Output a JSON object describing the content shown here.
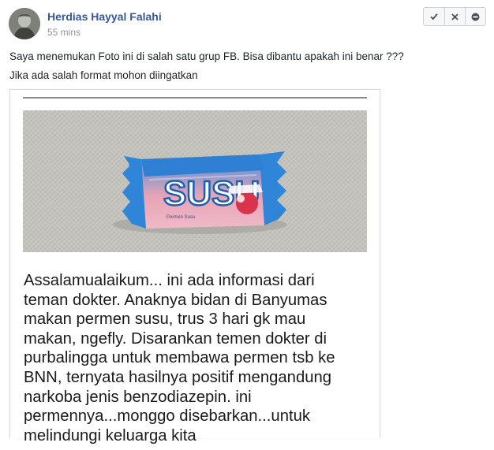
{
  "post": {
    "author": "Herdias Hayyal Falahi",
    "timestamp": "55 mins",
    "text_lines": [
      "Saya menemukan Foto ini di salah satu grup FB. Bisa dibantu apakah ini benar ???",
      "Jika ada salah format mohon diingatkan"
    ]
  },
  "moderation_actions": [
    {
      "name": "approve-button",
      "icon": "check-icon",
      "glyph": "✔"
    },
    {
      "name": "decline-button",
      "icon": "close-icon",
      "glyph": "✖"
    },
    {
      "name": "block-button",
      "icon": "minus-circle-icon",
      "glyph": "⊖"
    }
  ],
  "attachment": {
    "product": {
      "brand": "SUSU",
      "small_label": "Permen Susu",
      "colors": {
        "wrapper": "#2f86d8",
        "pink": "#e9a6b9",
        "red": "#d9344b",
        "white": "#ffffff"
      }
    },
    "caption_lines": [
      "Assalamualaikum... ini ada informasi dari",
      "teman dokter. Anaknya bidan di Banyumas",
      "makan permen susu, trus 3 hari gk mau",
      "makan, ngefly. Disarankan temen dokter di",
      "purbalingga untuk membawa permen tsb ke",
      "BNN, ternyata hasilnya positif mengandung",
      "narkoba jenis benzodiazepin. ini",
      "permennya...monggo disebarkan...untuk",
      "melindungi keluarga kita"
    ]
  },
  "colors": {
    "author_link": "#365899",
    "meta_gray": "#90949c",
    "text": "#1d2129"
  }
}
